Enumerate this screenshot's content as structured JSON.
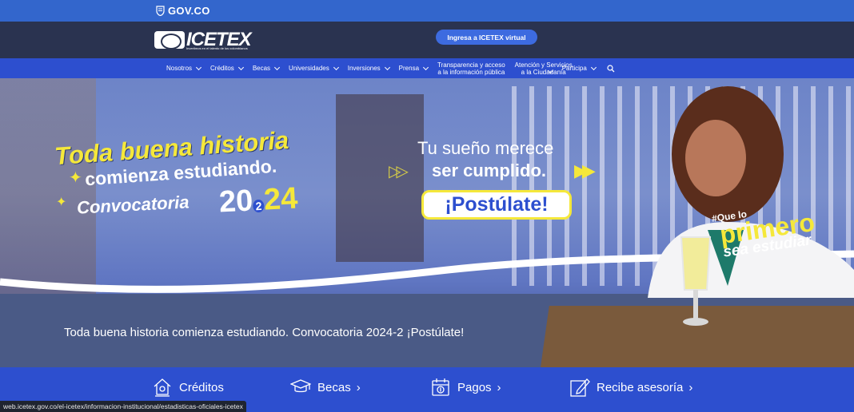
{
  "govbar": {
    "label": "GOV.CO"
  },
  "header": {
    "logo_text": "ICETEX",
    "logo_tagline": "Invertimos en el talento de los colombianos",
    "virtual_button": "Ingresa a ICETEX virtual"
  },
  "nav": {
    "items": [
      {
        "label": "Nosotros"
      },
      {
        "label": "Créditos"
      },
      {
        "label": "Becas"
      },
      {
        "label": "Universidades"
      },
      {
        "label": "Inversiones"
      },
      {
        "label": "Prensa"
      },
      {
        "label_line1": "Transparencia y acceso",
        "label_line2": "a la información pública"
      },
      {
        "label_line1": "Atención y Servicios",
        "label_line2": "a la Ciudadanía"
      },
      {
        "label": "Participa"
      }
    ],
    "search_icon": "search-icon"
  },
  "hero": {
    "title_line1": "Toda buena historia",
    "title_line2": "comienza estudiando.",
    "convocatoria": "Convocatoria",
    "year_a": "20",
    "year_sub": "2",
    "year_b": "24",
    "dream_line1": "Tu sueño merece",
    "dream_line2": "ser cumplido.",
    "cta": "¡Postúlate!",
    "hash_small": "#Que lo",
    "hash_big": "primero",
    "hash_end": "sea estudiar",
    "caption": "Toda buena historia comienza estudiando. Convocatoria 2024-2 ¡Postúlate!"
  },
  "quick_links": [
    {
      "label": "Créditos",
      "icon": "house-hand-icon"
    },
    {
      "label": "Becas",
      "icon": "graduation-cap-icon",
      "arrow": "›"
    },
    {
      "label": "Pagos",
      "icon": "calendar-money-icon",
      "arrow": "›"
    },
    {
      "label": "Recibe asesoría",
      "icon": "edit-note-icon",
      "arrow": "›"
    }
  ],
  "status_url": "web.icetex.gov.co/el-icetex/informacion-institucional/estadisticas-oficiales-icetex",
  "colors": {
    "gov_blue": "#3366cc",
    "nav_blue": "#2d4fcf",
    "header_dark": "#2a3350",
    "accent_yellow": "#f5e83a"
  }
}
